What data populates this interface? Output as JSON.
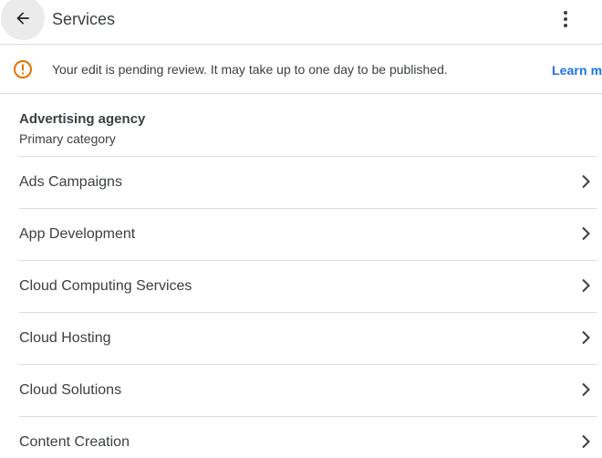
{
  "header": {
    "title": "Services",
    "back_icon": "arrow-back-icon",
    "more_icon": "more-vert-icon"
  },
  "notice": {
    "icon": "error-outline-icon",
    "text": "Your edit is pending review. It may take up to one day to be published.",
    "link_label": "Learn mo",
    "icon_color": "#e37400",
    "link_color": "#1a73e8"
  },
  "primary_category": {
    "name": "Advertising agency",
    "label": "Primary category"
  },
  "services": [
    {
      "label": "Ads Campaigns"
    },
    {
      "label": "App Development"
    },
    {
      "label": "Cloud Computing Services"
    },
    {
      "label": "Cloud Hosting"
    },
    {
      "label": "Cloud Solutions"
    },
    {
      "label": "Content Creation"
    }
  ]
}
